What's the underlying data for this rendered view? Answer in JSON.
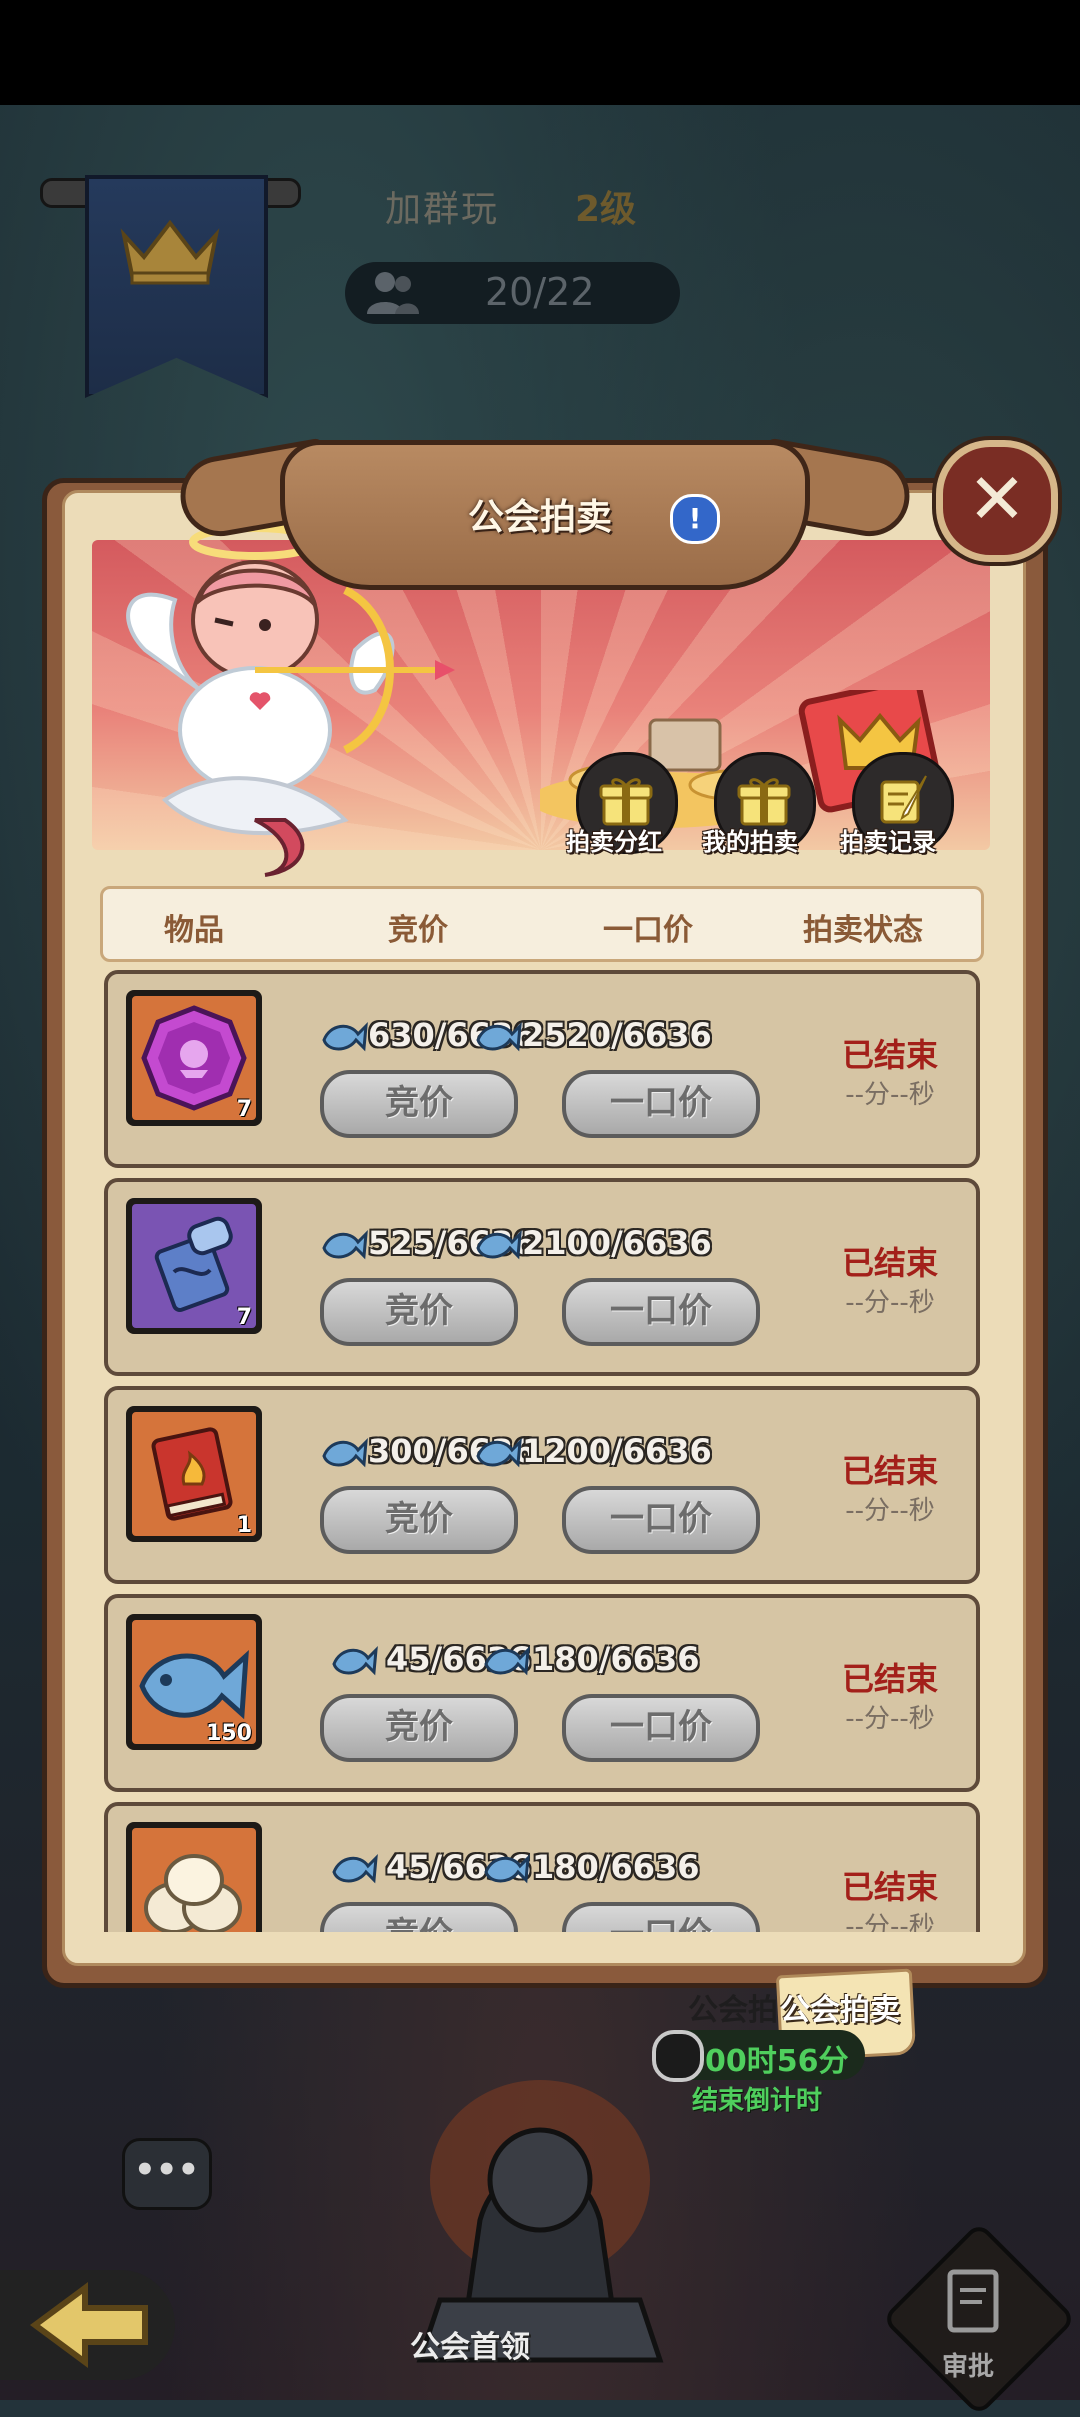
{
  "guild": {
    "name": "加群玩",
    "level": "2级",
    "members": "20/22"
  },
  "panel": {
    "title": "公会拍卖",
    "info_icon": "!",
    "close_icon": "✕"
  },
  "hero_buttons": [
    {
      "label": "拍卖分红",
      "icon": "gift-icon"
    },
    {
      "label": "我的拍卖",
      "icon": "gift-icon"
    },
    {
      "label": "拍卖记录",
      "icon": "scroll-quill-icon"
    }
  ],
  "columns": [
    "物品",
    "竞价",
    "一口价",
    "拍卖状态"
  ],
  "items": [
    {
      "name": "purple-gem-icon",
      "count": "7",
      "bid": "630/6636",
      "buyout": "2520/6636",
      "bid_label": "竞价",
      "buyout_label": "一口价",
      "status": "已结束",
      "timer": "--分--秒",
      "bg": "#d5743b"
    },
    {
      "name": "blue-scroll-icon",
      "count": "7",
      "bid": "525/6636",
      "buyout": "2100/6636",
      "bid_label": "竞价",
      "buyout_label": "一口价",
      "status": "已结束",
      "timer": "--分--秒",
      "bg": "#7a54b3"
    },
    {
      "name": "red-book-icon",
      "count": "1",
      "bid": "300/6636",
      "buyout": "1200/6636",
      "bid_label": "竞价",
      "buyout_label": "一口价",
      "status": "已结束",
      "timer": "--分--秒",
      "bg": "#d5743b"
    },
    {
      "name": "fish-icon",
      "count": "150",
      "bid": "45/6636",
      "buyout": "180/6636",
      "bid_label": "竞价",
      "buyout_label": "一口价",
      "status": "已结束",
      "timer": "--分--秒",
      "bg": "#d5743b"
    },
    {
      "name": "bun-icon",
      "count": "",
      "bid": "45/6636",
      "buyout": "180/6636",
      "bid_label": "竞价",
      "buyout_label": "一口价",
      "status": "已结束",
      "timer": "--分--秒",
      "bg": "#d5743b"
    }
  ],
  "bottom": {
    "auction_tab": "公会拍卖",
    "auction_shadow": "公会拍",
    "countdown": "00时56分",
    "countdown_label": "结束倒计时",
    "chat": "•••",
    "boss_label": "公会首领",
    "review_label": "审批"
  },
  "colors": {
    "status_ended": "#a3201a",
    "countdown_green": "#4fcf5d"
  }
}
